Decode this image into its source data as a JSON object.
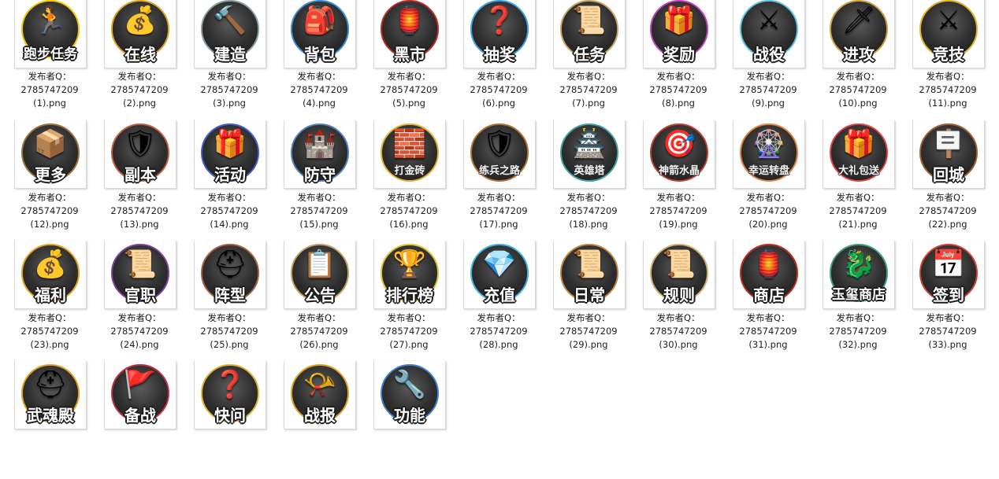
{
  "publisher_prefix": "发布者Q：",
  "publisher_id": "2785747209",
  "files": [
    {
      "label": "跑步任务",
      "file": "(1).png",
      "glyph": "🏃",
      "color": "#f5c400",
      "style": "long"
    },
    {
      "label": "在线",
      "file": "(2).png",
      "glyph": "💰",
      "color": "#e0a020",
      "style": "normal"
    },
    {
      "label": "建造",
      "file": "(3).png",
      "glyph": "🔨",
      "color": "#8a9aa0",
      "style": "normal"
    },
    {
      "label": "背包",
      "file": "(4).png",
      "glyph": "🎒",
      "color": "#3a8ad6",
      "style": "normal"
    },
    {
      "label": "黑市",
      "file": "(5).png",
      "glyph": "🏮",
      "color": "#c02a20",
      "style": "normal"
    },
    {
      "label": "抽奖",
      "file": "(6).png",
      "glyph": "❓",
      "color": "#3aa0e0",
      "style": "normal"
    },
    {
      "label": "任务",
      "file": "(7).png",
      "glyph": "📜",
      "color": "#c8a060",
      "style": "normal"
    },
    {
      "label": "奖励",
      "file": "(8).png",
      "glyph": "🎁",
      "color": "#c040c0",
      "style": "normal"
    },
    {
      "label": "战役",
      "file": "(9).png",
      "glyph": "⚔",
      "color": "#60c0e0",
      "style": "normal"
    },
    {
      "label": "进攻",
      "file": "(10).png",
      "glyph": "🗡",
      "color": "#d0a040",
      "style": "normal"
    },
    {
      "label": "竞技",
      "file": "(11).png",
      "glyph": "⚔",
      "color": "#e0b020",
      "style": "normal"
    },
    {
      "label": "更多",
      "file": "(12).png",
      "glyph": "📦",
      "color": "#a07040",
      "style": "normal"
    },
    {
      "label": "副本",
      "file": "(13).png",
      "glyph": "🛡",
      "color": "#c06040",
      "style": "normal"
    },
    {
      "label": "活动",
      "file": "(14).png",
      "glyph": "🎁",
      "color": "#4060d0",
      "style": "normal"
    },
    {
      "label": "防守",
      "file": "(15).png",
      "glyph": "🏰",
      "color": "#5080c0",
      "style": "normal"
    },
    {
      "label": "打金砖",
      "file": "(16).png",
      "glyph": "🧱",
      "color": "#e0b030",
      "style": "small"
    },
    {
      "label": "练兵之路",
      "file": "(17).png",
      "glyph": "🛡",
      "color": "#b07030",
      "style": "small"
    },
    {
      "label": "英雄塔",
      "file": "(18).png",
      "glyph": "🏯",
      "color": "#40a0a0",
      "style": "small"
    },
    {
      "label": "神箭水晶",
      "file": "(19).png",
      "glyph": "🎯",
      "color": "#c04030",
      "style": "small"
    },
    {
      "label": "幸运转盘",
      "file": "(20).png",
      "glyph": "🎡",
      "color": "#e08040",
      "style": "small"
    },
    {
      "label": "大礼包送",
      "file": "(21).png",
      "glyph": "🎁",
      "color": "#e04040",
      "style": "small"
    },
    {
      "label": "回城",
      "file": "(22).png",
      "glyph": "🪧",
      "color": "#a06030",
      "style": "normal"
    },
    {
      "label": "福利",
      "file": "(23).png",
      "glyph": "💰",
      "color": "#e0a020",
      "style": "normal"
    },
    {
      "label": "官职",
      "file": "(24).png",
      "glyph": "📜",
      "color": "#8040a0",
      "style": "normal"
    },
    {
      "label": "阵型",
      "file": "(25).png",
      "glyph": "⛑",
      "color": "#a06040",
      "style": "normal"
    },
    {
      "label": "公告",
      "file": "(26).png",
      "glyph": "📋",
      "color": "#c0a060",
      "style": "normal"
    },
    {
      "label": "排行榜",
      "file": "(27).png",
      "glyph": "🏆",
      "color": "#e0c030",
      "style": "normal"
    },
    {
      "label": "充值",
      "file": "(28).png",
      "glyph": "💎",
      "color": "#40b0e0",
      "style": "normal"
    },
    {
      "label": "日常",
      "file": "(29).png",
      "glyph": "📜",
      "color": "#c08040",
      "style": "normal"
    },
    {
      "label": "规则",
      "file": "(30).png",
      "glyph": "📜",
      "color": "#d0b070",
      "style": "normal"
    },
    {
      "label": "商店",
      "file": "(31).png",
      "glyph": "🏮",
      "color": "#c03020",
      "style": "normal"
    },
    {
      "label": "玉玺商店",
      "file": "(32).png",
      "glyph": "🐉",
      "color": "#40a080",
      "style": "long"
    },
    {
      "label": "签到",
      "file": "(33).png",
      "glyph": "📅",
      "color": "#d04030",
      "style": "normal"
    },
    {
      "label": "武魂殿",
      "file": "",
      "glyph": "⛑",
      "color": "#e0a020",
      "style": "normal"
    },
    {
      "label": "备战",
      "file": "",
      "glyph": "🚩",
      "color": "#c03040",
      "style": "normal"
    },
    {
      "label": "快问",
      "file": "",
      "glyph": "❓",
      "color": "#e0b030",
      "style": "normal"
    },
    {
      "label": "战报",
      "file": "",
      "glyph": "📯",
      "color": "#e0a020",
      "style": "normal"
    },
    {
      "label": "功能",
      "file": "",
      "glyph": "🔧",
      "color": "#4080d0",
      "style": "normal"
    }
  ]
}
